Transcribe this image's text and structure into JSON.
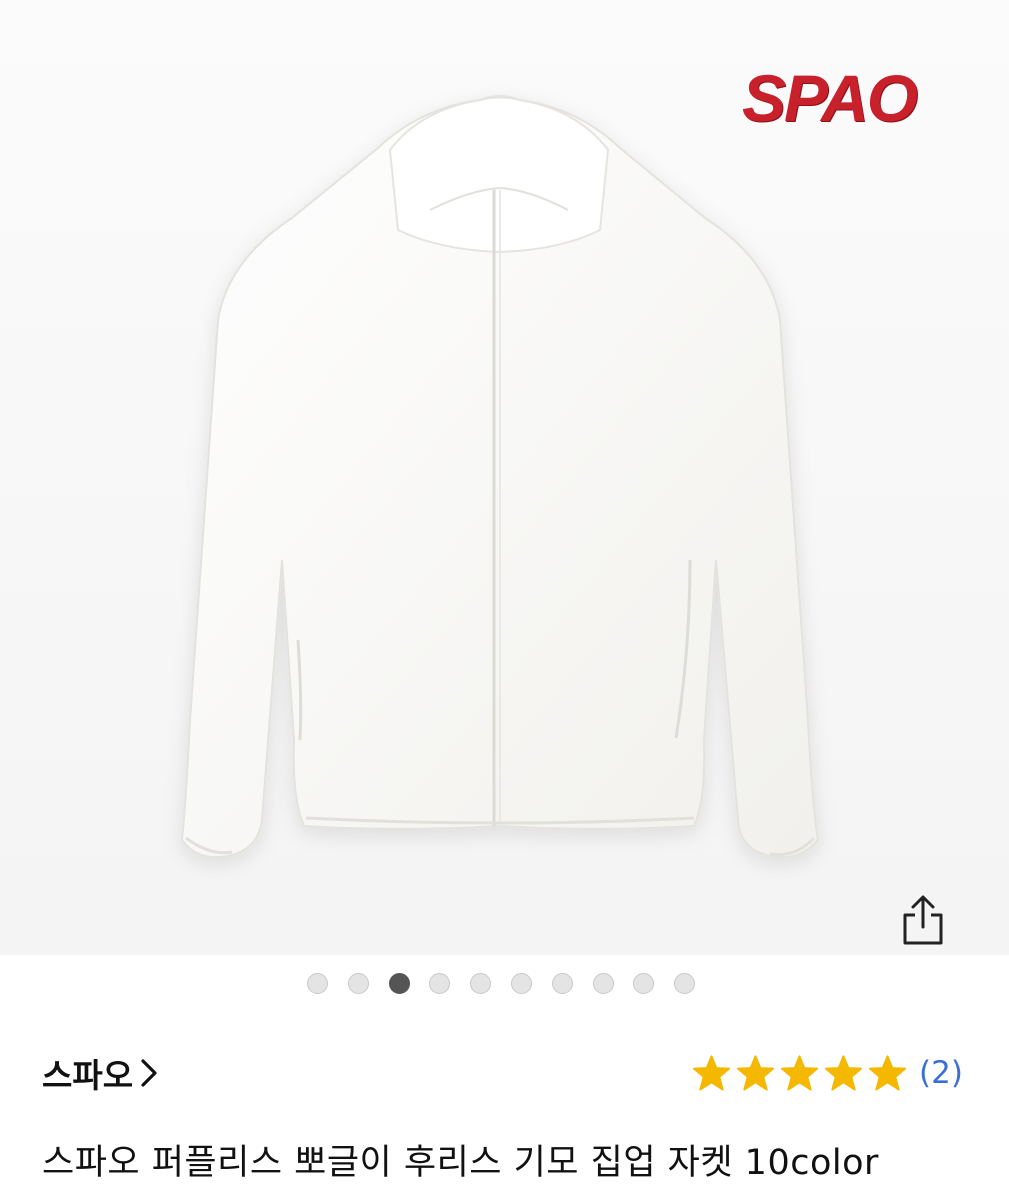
{
  "product_image": {
    "brand_logo_text": "SPAO",
    "brand_logo_color": "#c8212b",
    "share_icon": "share-icon"
  },
  "gallery": {
    "total_images": 10,
    "active_index": 2
  },
  "brand": {
    "name": "스파오",
    "chevron_icon": "chevron-right-icon"
  },
  "rating": {
    "stars": 5,
    "star_color": "#f5b800",
    "review_count": "(2)",
    "count_color": "#3a6fd8"
  },
  "product": {
    "title": "스파오 퍼플리스 뽀글이 후리스 기모 집업 자켓 10color"
  }
}
